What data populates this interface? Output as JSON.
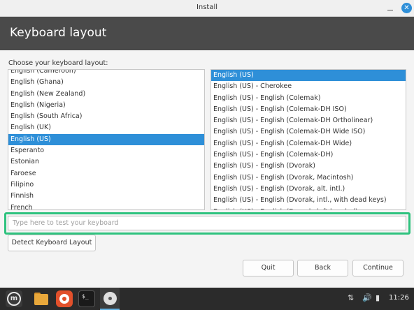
{
  "window": {
    "title": "Install",
    "minimize_glyph": "–",
    "close_glyph": "✕"
  },
  "header": {
    "title": "Keyboard layout"
  },
  "prompt": "Choose your keyboard layout:",
  "layouts": [
    {
      "label": "English (Cameroon)",
      "selected": false
    },
    {
      "label": "English (Ghana)",
      "selected": false
    },
    {
      "label": "English (New Zealand)",
      "selected": false
    },
    {
      "label": "English (Nigeria)",
      "selected": false
    },
    {
      "label": "English (South Africa)",
      "selected": false
    },
    {
      "label": "English (UK)",
      "selected": false
    },
    {
      "label": "English (US)",
      "selected": true
    },
    {
      "label": "Esperanto",
      "selected": false
    },
    {
      "label": "Estonian",
      "selected": false
    },
    {
      "label": "Faroese",
      "selected": false
    },
    {
      "label": "Filipino",
      "selected": false
    },
    {
      "label": "Finnish",
      "selected": false
    },
    {
      "label": "French",
      "selected": false
    }
  ],
  "variants": [
    {
      "label": "English (US)",
      "selected": true
    },
    {
      "label": "English (US) - Cherokee",
      "selected": false
    },
    {
      "label": "English (US) - English (Colemak)",
      "selected": false
    },
    {
      "label": "English (US) - English (Colemak-DH ISO)",
      "selected": false
    },
    {
      "label": "English (US) - English (Colemak-DH Ortholinear)",
      "selected": false
    },
    {
      "label": "English (US) - English (Colemak-DH Wide ISO)",
      "selected": false
    },
    {
      "label": "English (US) - English (Colemak-DH Wide)",
      "selected": false
    },
    {
      "label": "English (US) - English (Colemak-DH)",
      "selected": false
    },
    {
      "label": "English (US) - English (Dvorak)",
      "selected": false
    },
    {
      "label": "English (US) - English (Dvorak, Macintosh)",
      "selected": false
    },
    {
      "label": "English (US) - English (Dvorak, alt. intl.)",
      "selected": false
    },
    {
      "label": "English (US) - English (Dvorak, intl., with dead keys)",
      "selected": false
    },
    {
      "label": "English (US) - English (Dvorak, left-handed)",
      "selected": false
    }
  ],
  "test_input": {
    "placeholder": "Type here to test your keyboard",
    "value": ""
  },
  "buttons": {
    "detect": "Detect Keyboard Layout",
    "quit": "Quit",
    "back": "Back",
    "continue": "Continue"
  },
  "taskbar": {
    "menu_glyph": "m",
    "terminal_glyph": "$_",
    "tray": {
      "network_glyph": "⇅",
      "volume_glyph": "🔊",
      "battery_glyph": "▮"
    },
    "clock": "11:26"
  },
  "colors": {
    "selection": "#2e8fd8",
    "highlight": "#2ec27e",
    "header": "#4a4a4a"
  }
}
